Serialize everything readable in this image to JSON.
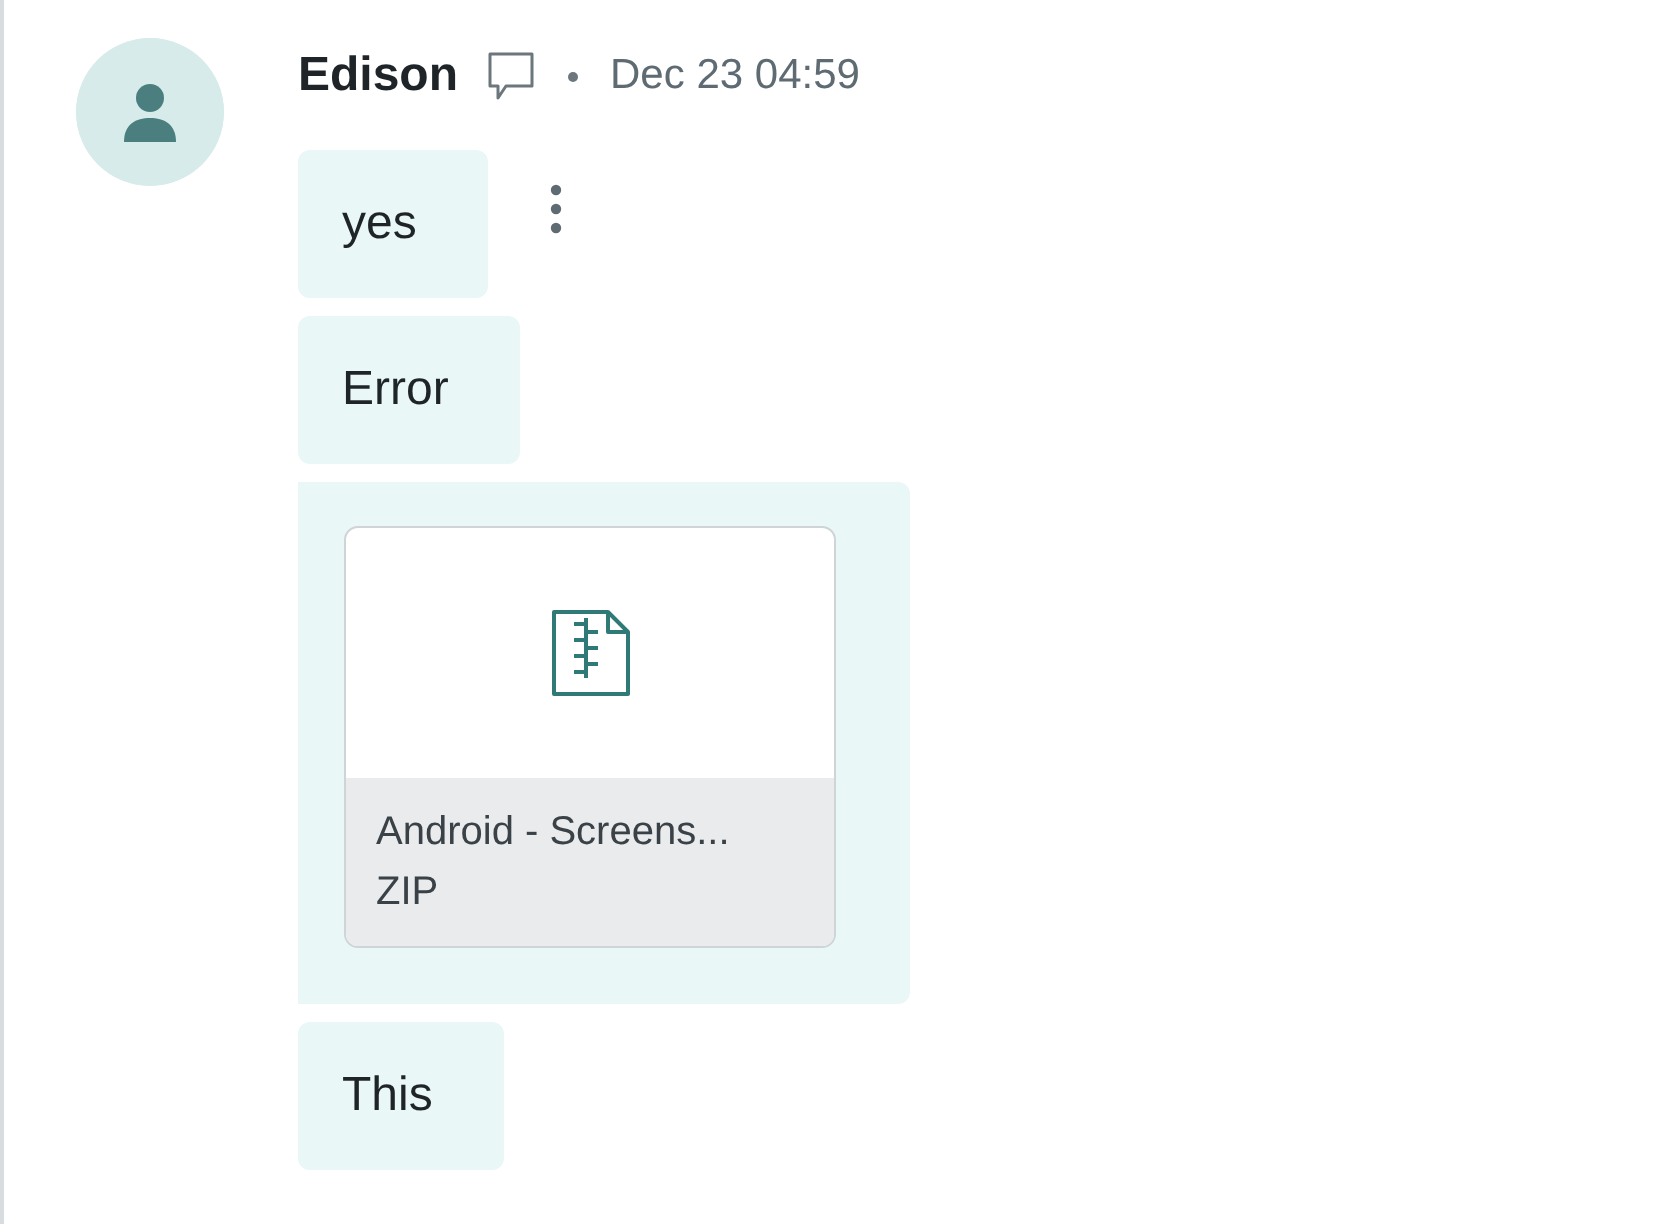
{
  "message": {
    "author": "Edison",
    "date": "Dec 23 04:59",
    "items": [
      {
        "kind": "text",
        "text": "yes",
        "menu_shown": true
      },
      {
        "kind": "text",
        "text": "Error",
        "menu_shown": false
      },
      {
        "kind": "file",
        "name": "Android - Screens...",
        "type": "ZIP",
        "menu_shown": false
      },
      {
        "kind": "text",
        "text": "This",
        "menu_shown": false
      }
    ]
  }
}
